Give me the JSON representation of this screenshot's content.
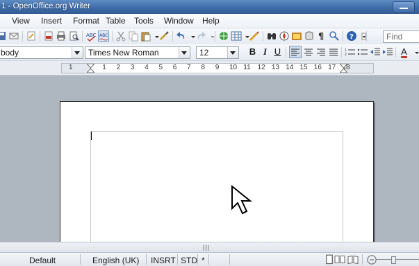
{
  "window": {
    "title": "1 - OpenOffice.org Writer"
  },
  "menu": {
    "view": "View",
    "insert": "Insert",
    "format": "Format",
    "table": "Table",
    "tools": "Tools",
    "window": "Window",
    "help": "Help"
  },
  "toolbar": {
    "find_placeholder": "Find"
  },
  "formatting": {
    "paragraph_style": "body",
    "font_name": "Times New Roman",
    "font_size": "12",
    "bold": "B",
    "italic": "I",
    "underline": "U",
    "font_color_label": "A"
  },
  "ruler": {
    "numbers": [
      "1",
      "1",
      "2",
      "3",
      "4",
      "5",
      "6",
      "7",
      "8",
      "9",
      "10",
      "11",
      "12",
      "13",
      "14",
      "15",
      "16",
      "17",
      "18"
    ]
  },
  "statusbar": {
    "page_style": "Default",
    "language": "English (UK)",
    "insert_mode": "INSRT",
    "selection_mode": "STD",
    "modified": "*"
  },
  "colors": {
    "titlebar": "#3d6aa6",
    "workspace": "#aeb6bf"
  }
}
